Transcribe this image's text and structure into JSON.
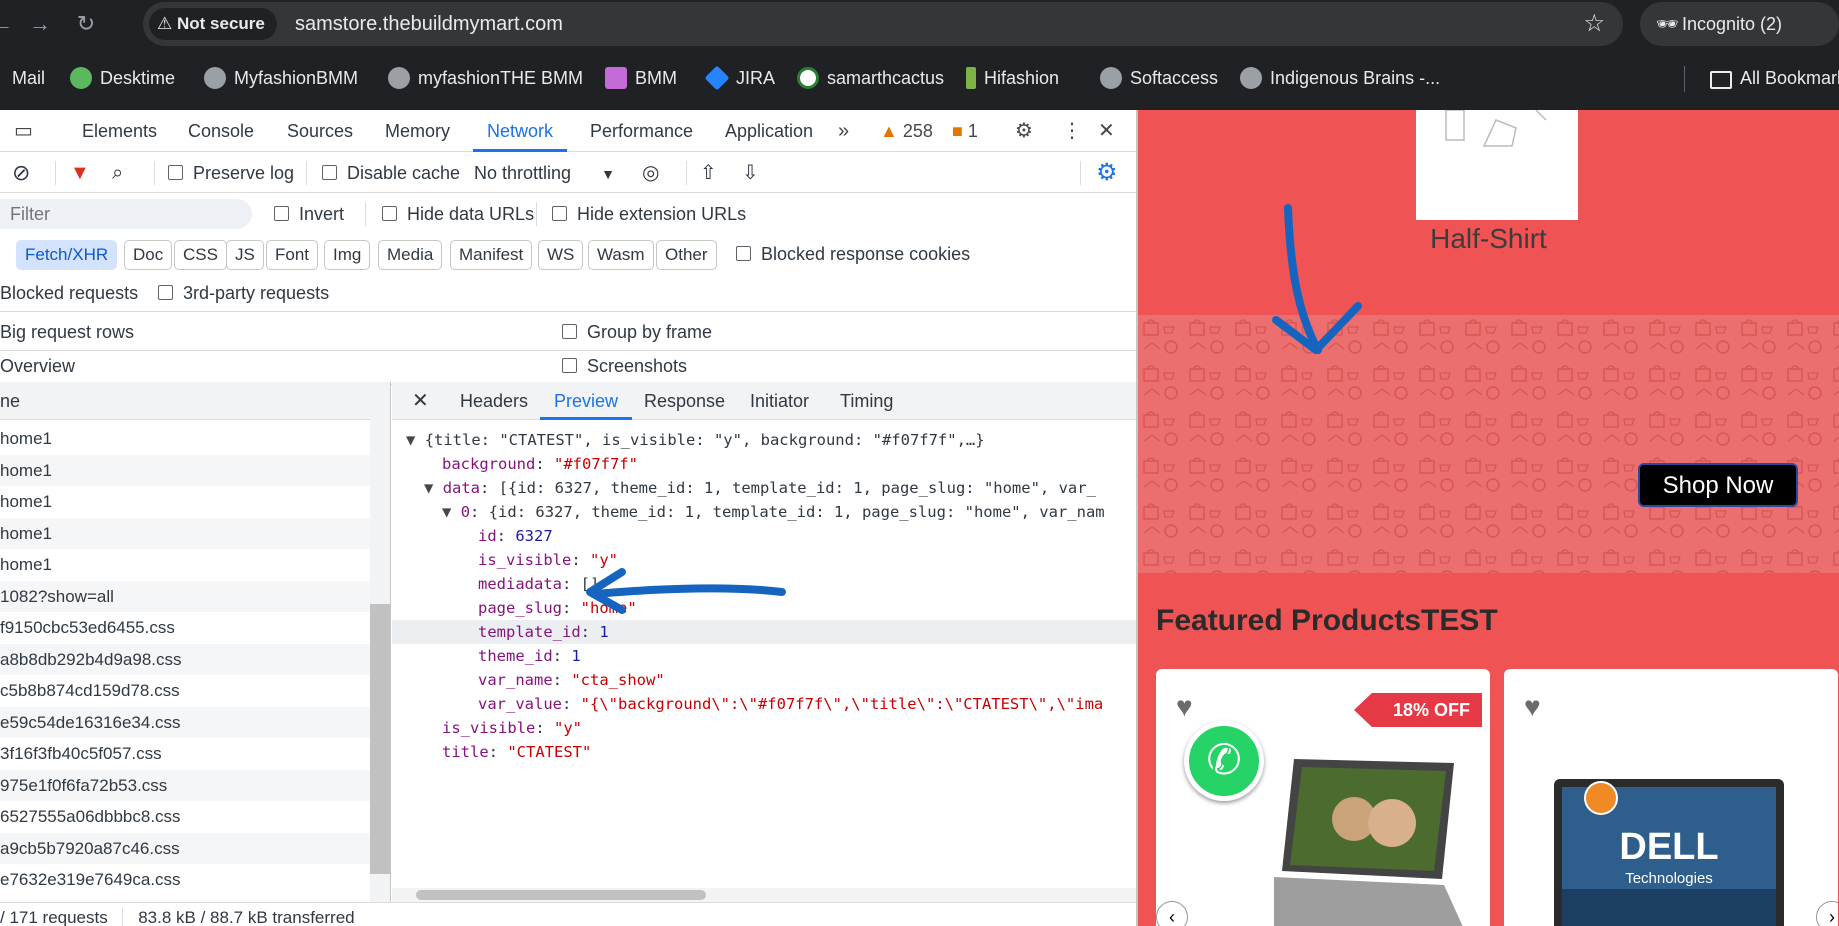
{
  "browser": {
    "security_label": "Not secure",
    "url": "samstore.thebuildmymart.com",
    "incognito_label": "Incognito (2)"
  },
  "bookmarks": [
    {
      "label": "Mail",
      "icon": "mail-icon"
    },
    {
      "label": "Desktime",
      "icon": "desktime-icon"
    },
    {
      "label": "MyfashionBMM",
      "icon": "globe-icon"
    },
    {
      "label": "myfashionTHE BMM",
      "icon": "globe-icon"
    },
    {
      "label": "BMM",
      "icon": "bmm-icon"
    },
    {
      "label": "JIRA",
      "icon": "jira-icon"
    },
    {
      "label": "samarthcactus",
      "icon": "cactus-icon"
    },
    {
      "label": "Hifashion",
      "icon": "hifashion-icon"
    },
    {
      "label": "Softaccess",
      "icon": "globe-icon"
    },
    {
      "label": "Indigenous Brains -...",
      "icon": "globe-icon"
    },
    {
      "label": "All Bookmarks",
      "icon": "folder-icon"
    }
  ],
  "devtools": {
    "tabs": [
      "Elements",
      "Console",
      "Sources",
      "Memory",
      "Network",
      "Performance",
      "Application"
    ],
    "warnings_count": "258",
    "issues_count": "1",
    "toolbar": {
      "preserve_log": "Preserve log",
      "disable_cache": "Disable cache",
      "throttling": "No throttling"
    },
    "filter": {
      "placeholder": "Filter",
      "invert": "Invert",
      "hide_data_urls": "Hide data URLs",
      "hide_extension_urls": "Hide extension URLs"
    },
    "type_filters": [
      "Fetch/XHR",
      "Doc",
      "CSS",
      "JS",
      "Font",
      "Img",
      "Media",
      "Manifest",
      "WS",
      "Wasm",
      "Other"
    ],
    "blocked_response_cookies": "Blocked response cookies",
    "blocked_requests": "Blocked requests",
    "third_party": "3rd-party requests",
    "big_request_rows": "Big request rows",
    "group_by_frame": "Group by frame",
    "overview": "Overview",
    "screenshots": "Screenshots",
    "request_list": {
      "header": "ne",
      "rows": [
        "home1",
        "home1",
        "home1",
        "home1",
        "home1",
        "1082?show=all",
        "f9150cbc53ed6455.css",
        "a8b8db292b4d9a98.css",
        "c5b8b874cd159d78.css",
        "e59c54de16316e34.css",
        "3f16f3fb40c5f057.css",
        "975e1f0f6fa72b53.css",
        "6527555a06dbbbc8.css",
        "a9cb5b7920a87c46.css",
        "e7632e319e7649ca.css"
      ]
    },
    "detail_tabs": [
      "Headers",
      "Preview",
      "Response",
      "Initiator",
      "Timing"
    ],
    "preview": {
      "root_summary": "{title: \"CTATEST\", is_visible: \"y\", background: \"#f07f7f\",…}",
      "background_key": "background",
      "background_val": "\"#f07f7f\"",
      "data_key": "data",
      "data_summary": "[{id: 6327, theme_id: 1, template_id: 1, page_slug: \"home\", var_",
      "item0_key": "0",
      "item0_summary": "{id: 6327, theme_id: 1, template_id: 1, page_slug: \"home\", var_nam",
      "id_key": "id",
      "id_val": "6327",
      "isvis_key": "is_visible",
      "isvis_val": "\"y\"",
      "media_key": "mediadata",
      "media_val": "[]",
      "slug_key": "page_slug",
      "slug_val": "\"home\"",
      "tpl_key": "template_id",
      "tpl_val": "1",
      "theme_key": "theme_id",
      "theme_val": "1",
      "varname_key": "var_name",
      "varname_val": "\"cta_show\"",
      "varval_key": "var_value",
      "varval_val": "\"{\\\"background\\\":\\\"#f07f7f\\\",\\\"title\\\":\\\"CTATEST\\\",\\\"ima",
      "root_isvis_key": "is_visible",
      "root_isvis_val": "\"y\"",
      "title_key": "title",
      "title_val": "\"CTATEST\""
    },
    "status": {
      "requests": "/ 171 requests",
      "transferred": "83.8 kB / 88.7 kB transferred"
    }
  },
  "page": {
    "category_label": "Half-Shirt",
    "cta_button": "Shop Now",
    "featured_title": "Featured ProductsTEST",
    "discount_badge": "18% OFF"
  },
  "colors": {
    "page_bg": "#f05354",
    "cta_bg": "#f07f7f",
    "accent": "#1a73e8",
    "annotation": "#1565c0"
  }
}
